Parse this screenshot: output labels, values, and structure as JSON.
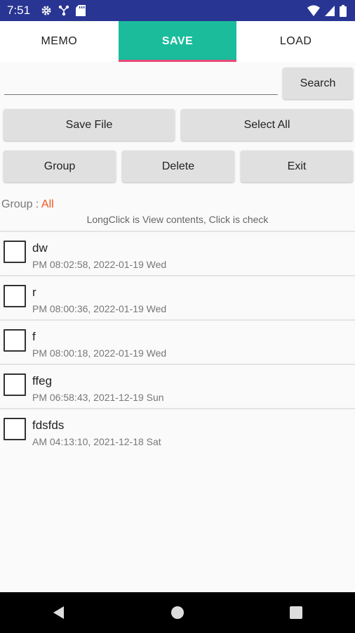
{
  "status_bar": {
    "time": "7:51",
    "icons_left": [
      "gear-icon",
      "network-icon",
      "sdcard-icon"
    ],
    "icons_right": [
      "wifi-icon",
      "cellular-icon",
      "battery-icon"
    ]
  },
  "tabs": [
    {
      "label": "MEMO",
      "active": false
    },
    {
      "label": "SAVE",
      "active": true
    },
    {
      "label": "LOAD",
      "active": false
    }
  ],
  "search": {
    "value": "",
    "placeholder": "",
    "button_label": "Search"
  },
  "buttons": {
    "save_file": "Save File",
    "select_all": "Select All",
    "group": "Group",
    "delete": "Delete",
    "exit": "Exit"
  },
  "group": {
    "label": "Group : ",
    "value": "All"
  },
  "hint": "LongClick is View contents, Click is check",
  "items": [
    {
      "title": "dw",
      "date": "PM 08:02:58, 2022-01-19 Wed"
    },
    {
      "title": "r",
      "date": "PM 08:00:36, 2022-01-19 Wed"
    },
    {
      "title": "f",
      "date": "PM 08:00:18, 2022-01-19 Wed"
    },
    {
      "title": "ffeg",
      "date": "PM 06:58:43, 2021-12-19 Sun"
    },
    {
      "title": "fdsfds",
      "date": "AM 04:13:10, 2021-12-18 Sat"
    }
  ],
  "nav_bar": {
    "icons": [
      "back-icon",
      "home-icon",
      "recents-icon"
    ]
  },
  "colors": {
    "status_bar": "#283593",
    "active_tab": "#1abc9c",
    "tab_indicator": "#e84a77",
    "group_value": "#f4511e",
    "button_bg": "#e0e0e0"
  }
}
